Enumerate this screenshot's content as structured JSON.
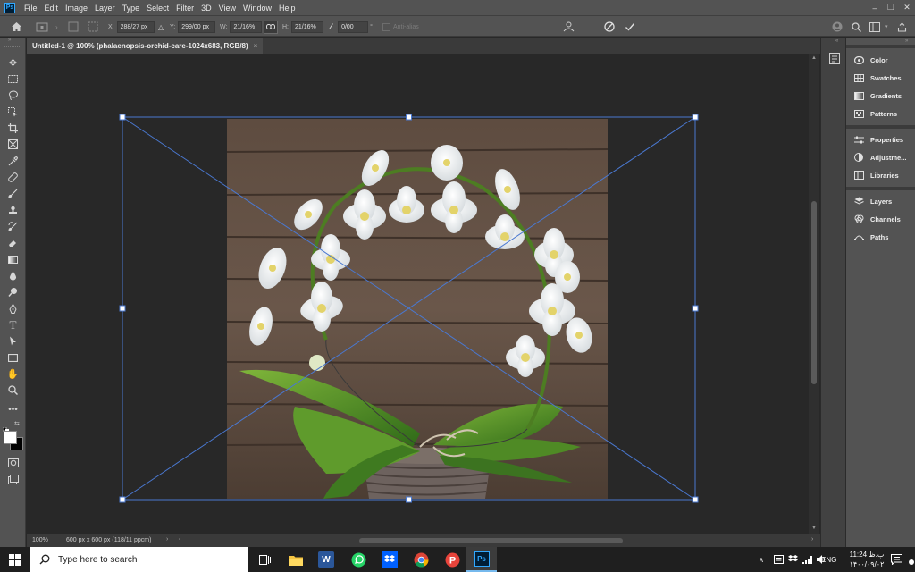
{
  "app": {
    "logo_text": "Ps"
  },
  "menu": [
    "File",
    "Edit",
    "Image",
    "Layer",
    "Type",
    "Select",
    "Filter",
    "3D",
    "View",
    "Window",
    "Help"
  ],
  "window_controls": {
    "minimize": "–",
    "restore": "❐",
    "close": "✕"
  },
  "options": {
    "x_label": "X:",
    "x_value": "288/27 px",
    "y_label": "Y:",
    "y_value": "299/00 px",
    "w_label": "W:",
    "w_value": "21/16%",
    "h_label": "H:",
    "h_value": "21/16%",
    "angle_value": "0/00",
    "angle_unit": "°",
    "anti_alias_label": "Anti-alias"
  },
  "document": {
    "tab_title": "Untitled-1 @ 100% (phalaenopsis-orchid-care-1024x683, RGB/8)",
    "tab_close": "×"
  },
  "status": {
    "zoom": "100%",
    "info": "600 px x 600 px (118/11 ppcm)"
  },
  "panels": [
    {
      "label": "Color",
      "icon": "color-wheel-icon"
    },
    {
      "label": "Swatches",
      "icon": "grid-icon"
    },
    {
      "label": "Gradients",
      "icon": "gradient-icon"
    },
    {
      "label": "Patterns",
      "icon": "pattern-icon"
    },
    {
      "label": "Properties",
      "icon": "sliders-icon"
    },
    {
      "label": "Adjustme...",
      "icon": "adjustment-icon"
    },
    {
      "label": "Libraries",
      "icon": "library-icon"
    },
    {
      "label": "Layers",
      "icon": "layers-icon"
    },
    {
      "label": "Channels",
      "icon": "channels-icon"
    },
    {
      "label": "Paths",
      "icon": "paths-icon"
    }
  ],
  "taskbar": {
    "search_placeholder": "Type here to search",
    "language": "ENG",
    "time": "11:24 ب.ظ",
    "date": "۱۴۰۰/۰۹/۰۲"
  },
  "colors": {
    "accent": "#31a8ff",
    "panel_bg": "#535353",
    "canvas_bg": "#282828",
    "transform_lines": "#4a78d0"
  }
}
